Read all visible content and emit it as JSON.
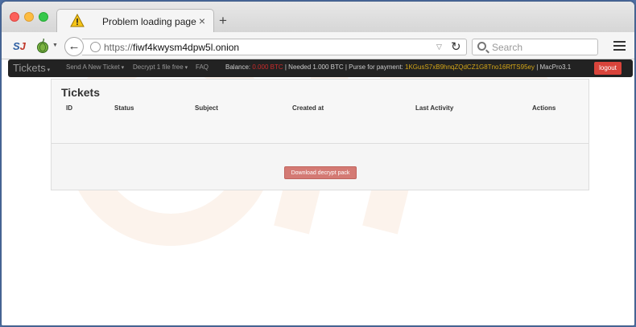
{
  "browser": {
    "tab_title": "Problem loading page",
    "tab_close": "×",
    "new_tab": "+",
    "url_prefix": "https://",
    "url_host": "fiwf4kwysm4dpw5l.onion",
    "search_placeholder": "Search",
    "ext_badge_s": "S",
    "ext_badge_j": "J"
  },
  "navbar": {
    "brand": "Tickets",
    "items": [
      "Send A New Ticket",
      "Decrypt 1 file free",
      "FAQ"
    ],
    "balance_label": "Balance:",
    "balance_value": "0.000 BTC",
    "needed_text": "| Needed 1.000 BTC | Purse for payment:",
    "purse": "1KGusS7xB9hnqZQdCZ1G8Tno16RfTS95ey",
    "user_text": "| MacPro3.1",
    "logout_label": "logout"
  },
  "tickets": {
    "title": "Tickets",
    "columns": [
      "ID",
      "Status",
      "Subject",
      "Created at",
      "Last Activity",
      "Actions"
    ],
    "rows": [],
    "download_button": "Download decrypt pack"
  },
  "colors": {
    "logout": "#d9443b",
    "balance_red": "#cc2b2b",
    "purse_yellow": "#d4a617",
    "download_button": "#d47a74"
  }
}
